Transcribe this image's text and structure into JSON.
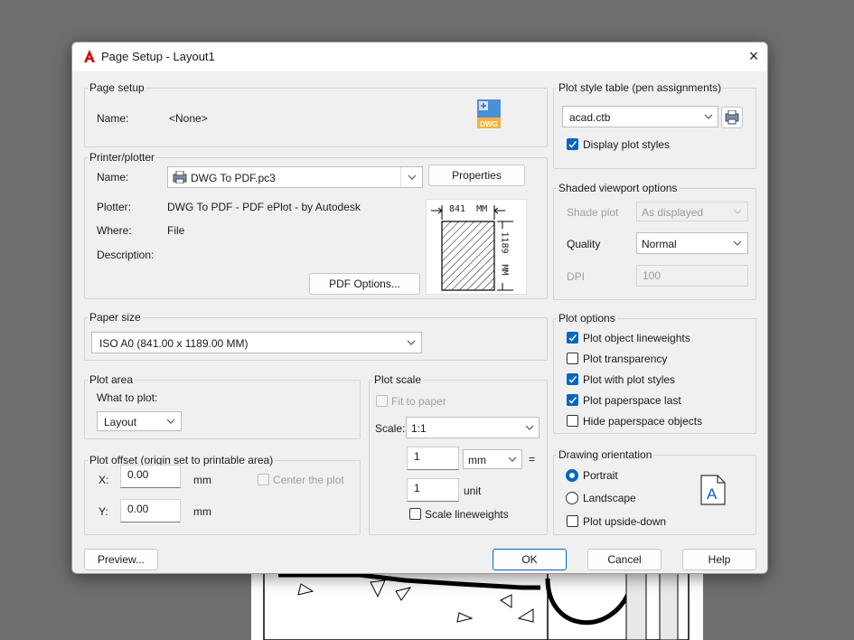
{
  "dialog": {
    "title": "Page Setup - Layout1",
    "close_label": "×"
  },
  "page_setup": {
    "legend": "Page setup",
    "name_label": "Name:",
    "name_value": "<None>"
  },
  "printer": {
    "legend": "Printer/plotter",
    "name_label": "Name:",
    "name_value": "DWG To PDF.pc3",
    "properties_label": "Properties",
    "plotter_label": "Plotter:",
    "plotter_value": "DWG To PDF - PDF ePlot - by Autodesk",
    "where_label": "Where:",
    "where_value": "File",
    "description_label": "Description:",
    "pdf_options_label": "PDF Options...",
    "preview_width": "841  MM",
    "preview_height": "1189  MM"
  },
  "paper_size": {
    "legend": "Paper size",
    "value": "ISO A0 (841.00 x 1189.00 MM)"
  },
  "plot_area": {
    "legend": "Plot area",
    "what_label": "What to plot:",
    "what_value": "Layout"
  },
  "plot_offset": {
    "legend": "Plot offset (origin set to printable area)",
    "x_label": "X:",
    "x_value": "0.00",
    "x_unit": "mm",
    "y_label": "Y:",
    "y_value": "0.00",
    "y_unit": "mm",
    "center_label": "Center the plot"
  },
  "plot_scale": {
    "legend": "Plot scale",
    "fit_label": "Fit to paper",
    "scale_label": "Scale:",
    "scale_value": "1:1",
    "num1": "1",
    "unit1": "mm",
    "equals": "=",
    "num2": "1",
    "unit2": "unit",
    "lineweights_label": "Scale lineweights"
  },
  "plot_style_table": {
    "legend": "Plot style table (pen assignments)",
    "value": "acad.ctb",
    "display_label": "Display plot styles"
  },
  "shaded": {
    "legend": "Shaded viewport options",
    "shade_label": "Shade plot",
    "shade_value": "As displayed",
    "quality_label": "Quality",
    "quality_value": "Normal",
    "dpi_label": "DPI",
    "dpi_value": "100"
  },
  "plot_options": {
    "legend": "Plot options",
    "items": [
      {
        "label": "Plot object lineweights",
        "checked": true
      },
      {
        "label": "Plot transparency",
        "checked": false
      },
      {
        "label": "Plot with plot styles",
        "checked": true
      },
      {
        "label": "Plot paperspace last",
        "checked": true
      },
      {
        "label": "Hide paperspace objects",
        "checked": false
      }
    ]
  },
  "orientation": {
    "legend": "Drawing orientation",
    "portrait_label": "Portrait",
    "landscape_label": "Landscape",
    "upside_label": "Plot upside-down"
  },
  "buttons": {
    "preview": "Preview...",
    "ok": "OK",
    "cancel": "Cancel",
    "help": "Help"
  },
  "colors": {
    "accent": "#0067c0",
    "app_icon": "#d40000"
  },
  "icons": {
    "app": "autocad-logo-icon",
    "dwg": "dwg-file-icon",
    "plotter": "plotter-icon",
    "orientation": "portrait-page-icon"
  }
}
